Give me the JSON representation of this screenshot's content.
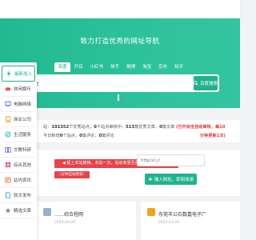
{
  "hero": {
    "title": "致力打造优秀的网址导航",
    "engines": [
      "百度",
      "开目",
      "小红书",
      "快手",
      "微博",
      "淘宝",
      "京东",
      "知乎"
    ],
    "search": {
      "value": "网",
      "button_label": "百度搜索"
    }
  },
  "sidebar": {
    "items": [
      {
        "label": "最新加入",
        "icon": "bolt-icon",
        "color": "#20b28f"
      },
      {
        "label": "休闲娱乐",
        "icon": "game-icon",
        "color": "#e85a5a"
      },
      {
        "label": "电脑网络",
        "icon": "computer-icon",
        "color": "#4a7fd9"
      },
      {
        "label": "商业公司",
        "icon": "building-icon",
        "color": "#f0a030"
      },
      {
        "label": "生活服务",
        "icon": "life-icon",
        "color": "#29b6c6"
      },
      {
        "label": "文教科研",
        "icon": "book-icon",
        "color": "#7c5cd6"
      },
      {
        "label": "综合其他",
        "icon": "grid-icon",
        "color": "#e0507a"
      },
      {
        "label": "站内资讯",
        "icon": "news-icon",
        "color": "#ea6a2a"
      },
      {
        "label": "软文发布",
        "icon": "doc-icon",
        "color": "#3a9be0"
      },
      {
        "label": "精选文章",
        "icon": "star-icon",
        "color": "#8a8a8a"
      }
    ]
  },
  "stats": {
    "line1_prefix": "站：",
    "total_sites": "192352",
    "line1_mid": "个优秀站点，",
    "pending": "0",
    "line1_mid2": "个站点审核中，",
    "articles": "513",
    "line1_mid3": "篇优秀文章，",
    "pending_articles": "0",
    "line1_mid4": "篇文章",
    "red_note_1": "(已开启全自动审核，每10",
    "line2_prefix": "今日新增",
    "today_sites": "0",
    "line2_mid": "个站点，",
    "today_articles": "0",
    "line2_mid2": "篇评论，",
    "today_comments": "0",
    "line2_mid3": "篇评论",
    "red_note_2": "分钟更新1次)"
  },
  "submit": {
    "notice": "提上本站链接，本站一次，后动收录至页面一次，先",
    "badge": "（分钟自动更新）",
    "url_placeholder": "http(s)://",
    "button_label": "输入网址，即刻收录"
  },
  "sites": [
    {
      "name": "……综合程网",
      "date": "2025-03-20",
      "logo_color": "#9ab0c8"
    },
    {
      "name": "东莞市公石数嘉电子厂",
      "date": "2025-03-20",
      "logo_color": "#f2a21a"
    }
  ]
}
